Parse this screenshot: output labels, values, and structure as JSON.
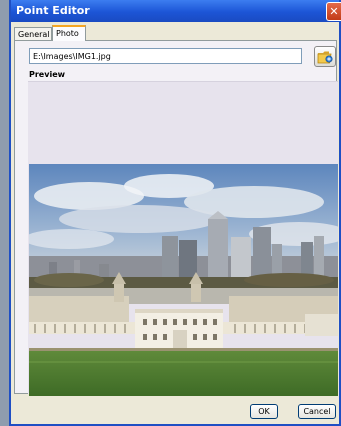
{
  "window": {
    "title": "Point Editor"
  },
  "tabs": [
    {
      "label": "General",
      "active": false
    },
    {
      "label": "Photo",
      "active": true
    }
  ],
  "photo_tab": {
    "file_path": "E:\\Images\\IMG1.jpg",
    "preview_label": "Preview"
  },
  "buttons": {
    "ok": "OK",
    "cancel": "Cancel"
  },
  "icons": {
    "close": "close-icon",
    "browse": "folder-icon"
  },
  "colors": {
    "titlebar": "#1c55d6",
    "active_tab_accent": "#f5a623",
    "close": "#c23b17"
  }
}
